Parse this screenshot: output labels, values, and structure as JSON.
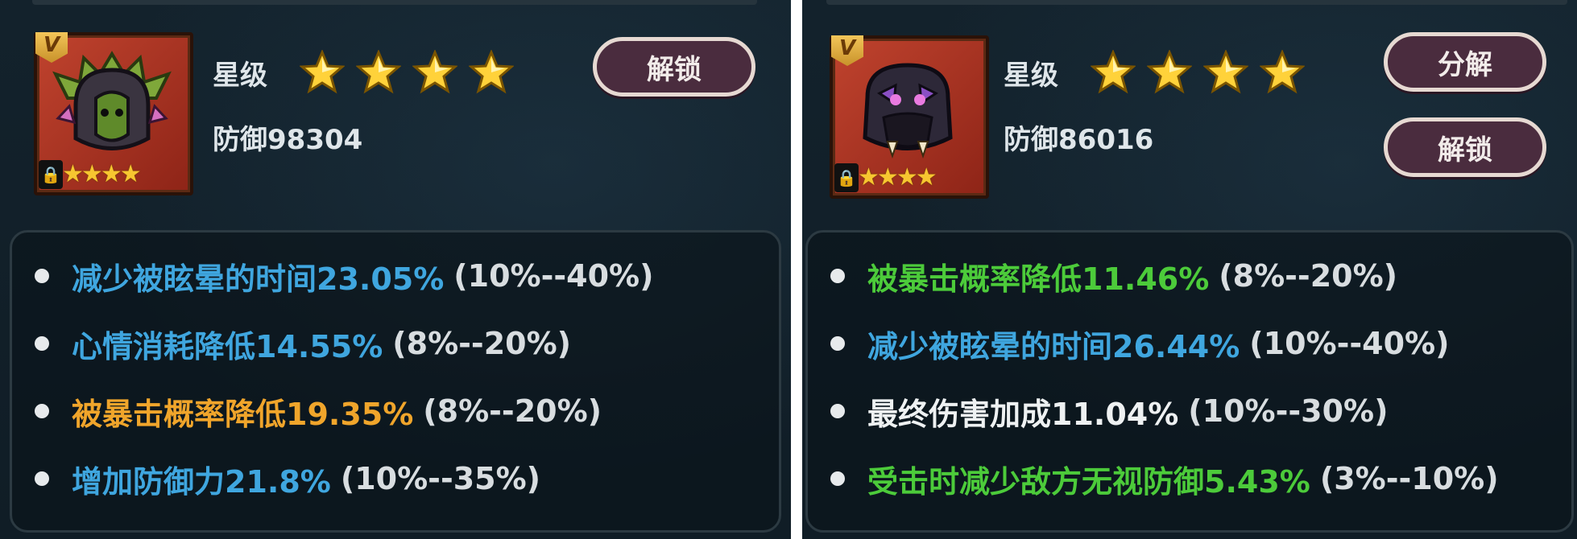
{
  "colors": {
    "blue": "#3fa6df",
    "orange": "#f0a52b",
    "green": "#4ccb3a",
    "white": "#eef1f2",
    "range": "#d8dde0"
  },
  "left": {
    "star_label": "星级",
    "star_count": 4,
    "icon_badge": "V",
    "icon_star_count": 4,
    "defense": "防御98304",
    "buttons": {
      "unlock": "解锁"
    },
    "attributes": [
      {
        "name": "减少被眩晕的时间23.05%",
        "range": "(10%--40%)",
        "color": "blue"
      },
      {
        "name": "心情消耗降低14.55%",
        "range": "(8%--20%)",
        "color": "blue"
      },
      {
        "name": "被暴击概率降低19.35%",
        "range": "(8%--20%)",
        "color": "orange"
      },
      {
        "name": "增加防御力21.8%",
        "range": "(10%--35%)",
        "color": "blue"
      }
    ]
  },
  "right": {
    "star_label": "星级",
    "star_count": 4,
    "icon_badge": "V",
    "icon_star_count": 4,
    "defense": "防御86016",
    "buttons": {
      "decompose": "分解",
      "unlock": "解锁"
    },
    "attributes": [
      {
        "name": "被暴击概率降低11.46%",
        "range": "(8%--20%)",
        "color": "green"
      },
      {
        "name": "减少被眩晕的时间26.44%",
        "range": "(10%--40%)",
        "color": "blue"
      },
      {
        "name": "最终伤害加成11.04%",
        "range": "(10%--30%)",
        "color": "white"
      },
      {
        "name": "受击时减少敌方无视防御5.43%",
        "range": "(3%--10%)",
        "color": "green"
      }
    ]
  }
}
